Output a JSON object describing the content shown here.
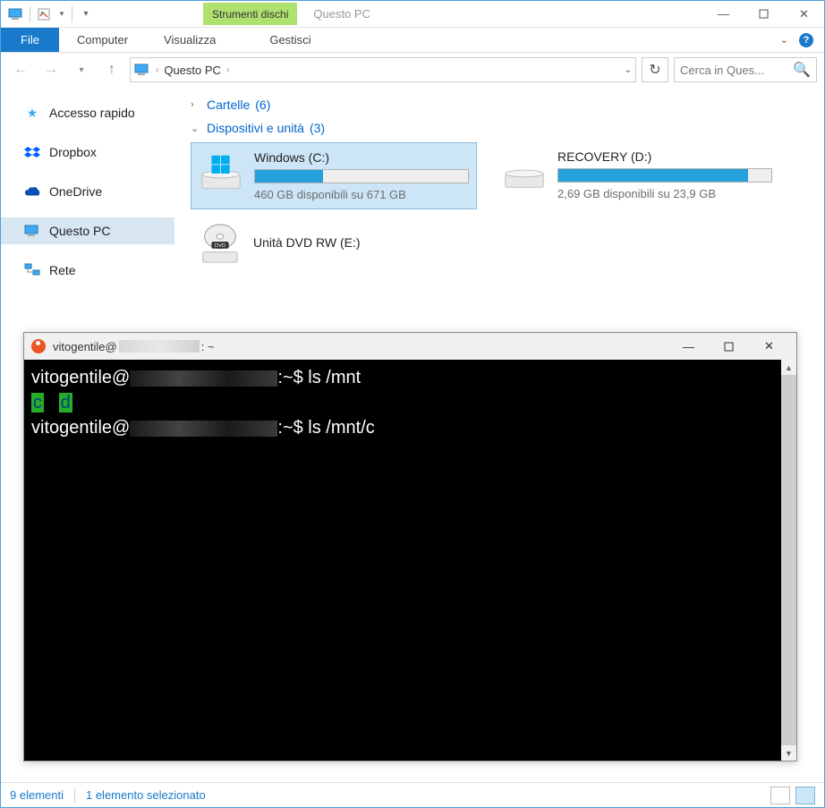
{
  "titlebar": {
    "contextual_tab": "Strumenti dischi",
    "title": "Questo PC"
  },
  "ribbon": {
    "file": "File",
    "computer": "Computer",
    "visualizza": "Visualizza",
    "gestisci": "Gestisci"
  },
  "addressbar": {
    "location": "Questo PC"
  },
  "search": {
    "placeholder": "Cerca in Ques..."
  },
  "sidebar": {
    "items": [
      {
        "label": "Accesso rapido"
      },
      {
        "label": "Dropbox"
      },
      {
        "label": "OneDrive"
      },
      {
        "label": "Questo PC"
      },
      {
        "label": "Rete"
      }
    ]
  },
  "groups": {
    "folders": {
      "label": "Cartelle",
      "count": "(6)"
    },
    "devices": {
      "label": "Dispositivi e unità",
      "count": "(3)"
    }
  },
  "drives": [
    {
      "title": "Windows (C:)",
      "sub": "460 GB disponibili su 671 GB",
      "fill": 32
    },
    {
      "title": "RECOVERY (D:)",
      "sub": "2,69 GB disponibili su 23,9 GB",
      "fill": 89
    },
    {
      "title": "Unità DVD RW (E:)",
      "sub": "",
      "fill": null
    }
  ],
  "terminal": {
    "title_user": "vitogentile@",
    "title_suffix": ": ~",
    "lines": {
      "p1_user": "vitogentile@",
      "p1_path": ":~$ ",
      "p1_cmd": "ls /mnt",
      "out_c": "c",
      "out_d": "d",
      "p2_user": "vitogentile@",
      "p2_path": ":~$ ",
      "p2_cmd": "ls /mnt/c"
    }
  },
  "statusbar": {
    "left": "9 elementi",
    "right": "1 elemento selezionato"
  }
}
